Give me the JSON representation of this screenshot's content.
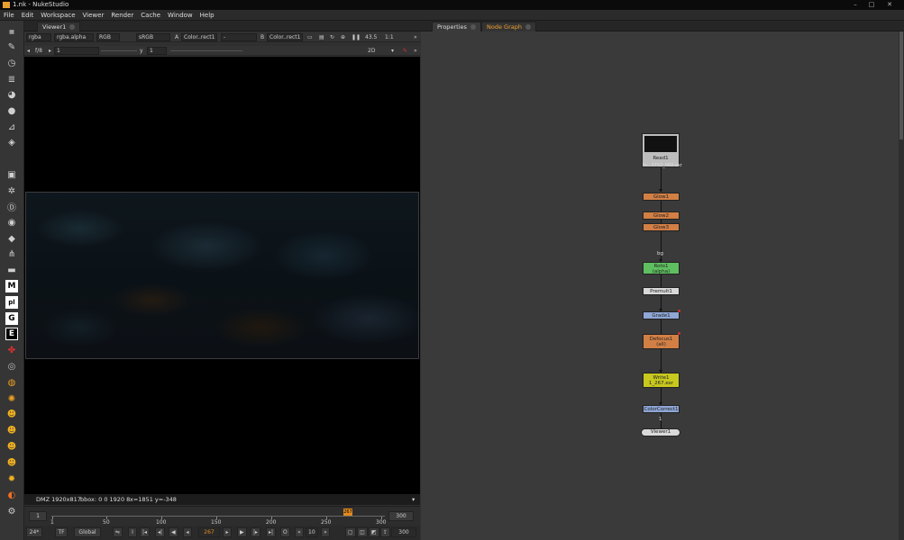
{
  "window": {
    "title": "1.nk - NukeStudio"
  },
  "menu": [
    "File",
    "Edit",
    "Workspace",
    "Viewer",
    "Render",
    "Cache",
    "Window",
    "Help"
  ],
  "viewer": {
    "tab": "Viewer1",
    "channels": "rgba",
    "channel_alpha": "rgba.alpha",
    "colorspace": "RGB",
    "lut": "sRGB",
    "a_label": "A",
    "a_input": "Color..rect1",
    "comp_op": "-",
    "b_label": "B",
    "b_input": "Color..rect1",
    "zoom": "43.5",
    "ratio": "1:1",
    "fstop": "f/8",
    "frame_field": "1",
    "y_label": "y",
    "y_value": "1",
    "mode": "2D",
    "info": {
      "format": "DMZ 1920x817",
      "bbox": "bbox: 0 0 1920 8",
      "coords": "x=1851 y=-348"
    }
  },
  "timeline": {
    "start": "1",
    "end": "300",
    "current": "267",
    "ticks": [
      "1",
      "50",
      "100",
      "150",
      "200",
      "250",
      "300"
    ]
  },
  "playback": {
    "fps": "24*",
    "tf": "TF",
    "global": "Global",
    "frame": "267",
    "step": "10",
    "end_frame": "300"
  },
  "panels": {
    "tab_properties": "Properties",
    "tab_nodegraph": "Node Graph"
  },
  "nodes": [
    {
      "label": "Read1",
      "sub": "hi...3752_068.exr",
      "color": "#bdbdbd"
    },
    {
      "label": "Glow1",
      "color": "#d27f45"
    },
    {
      "label": "Glow2",
      "color": "#d27f45"
    },
    {
      "label": "Glow3",
      "color": "#d27f45"
    },
    {
      "label": "bg"
    },
    {
      "label": "Roto1",
      "sub": "(alpha)",
      "color": "#5fbf60"
    },
    {
      "label": "Premult1",
      "color": "#d9d9d9"
    },
    {
      "label": "Grade1",
      "color": "#8fa6d6"
    },
    {
      "label": "Defocus1",
      "sub": "(all)",
      "color": "#d27f45"
    },
    {
      "label": "Write1",
      "sub": "1_267.exr",
      "color": "#c8c81e"
    },
    {
      "label": "ColorCorrect1",
      "color": "#8fa6d6"
    },
    {
      "label": "1"
    },
    {
      "label": "Viewer1",
      "color": "#d9d9d9"
    }
  ],
  "icons": [
    "pencil-icon",
    "clock-icon",
    "layers-icon",
    "sphere-icon",
    "circle-icon",
    "brush-icon",
    "stack-icon",
    "cube-icon",
    "particles-icon",
    "deep-icon",
    "eye-icon",
    "tag-icon",
    "keyer-icon",
    "toolset-icon",
    "m-plugin-icon",
    "pl-plugin-icon",
    "g-plugin-icon",
    "e-plugin-icon",
    "red-plugin-icon",
    "swirl-icon",
    "fire-icon",
    "spiral-icon",
    "face-icon",
    "face2-icon",
    "face3-icon",
    "face4-icon",
    "swirl2-icon",
    "gauge-icon",
    "settings-icon"
  ]
}
